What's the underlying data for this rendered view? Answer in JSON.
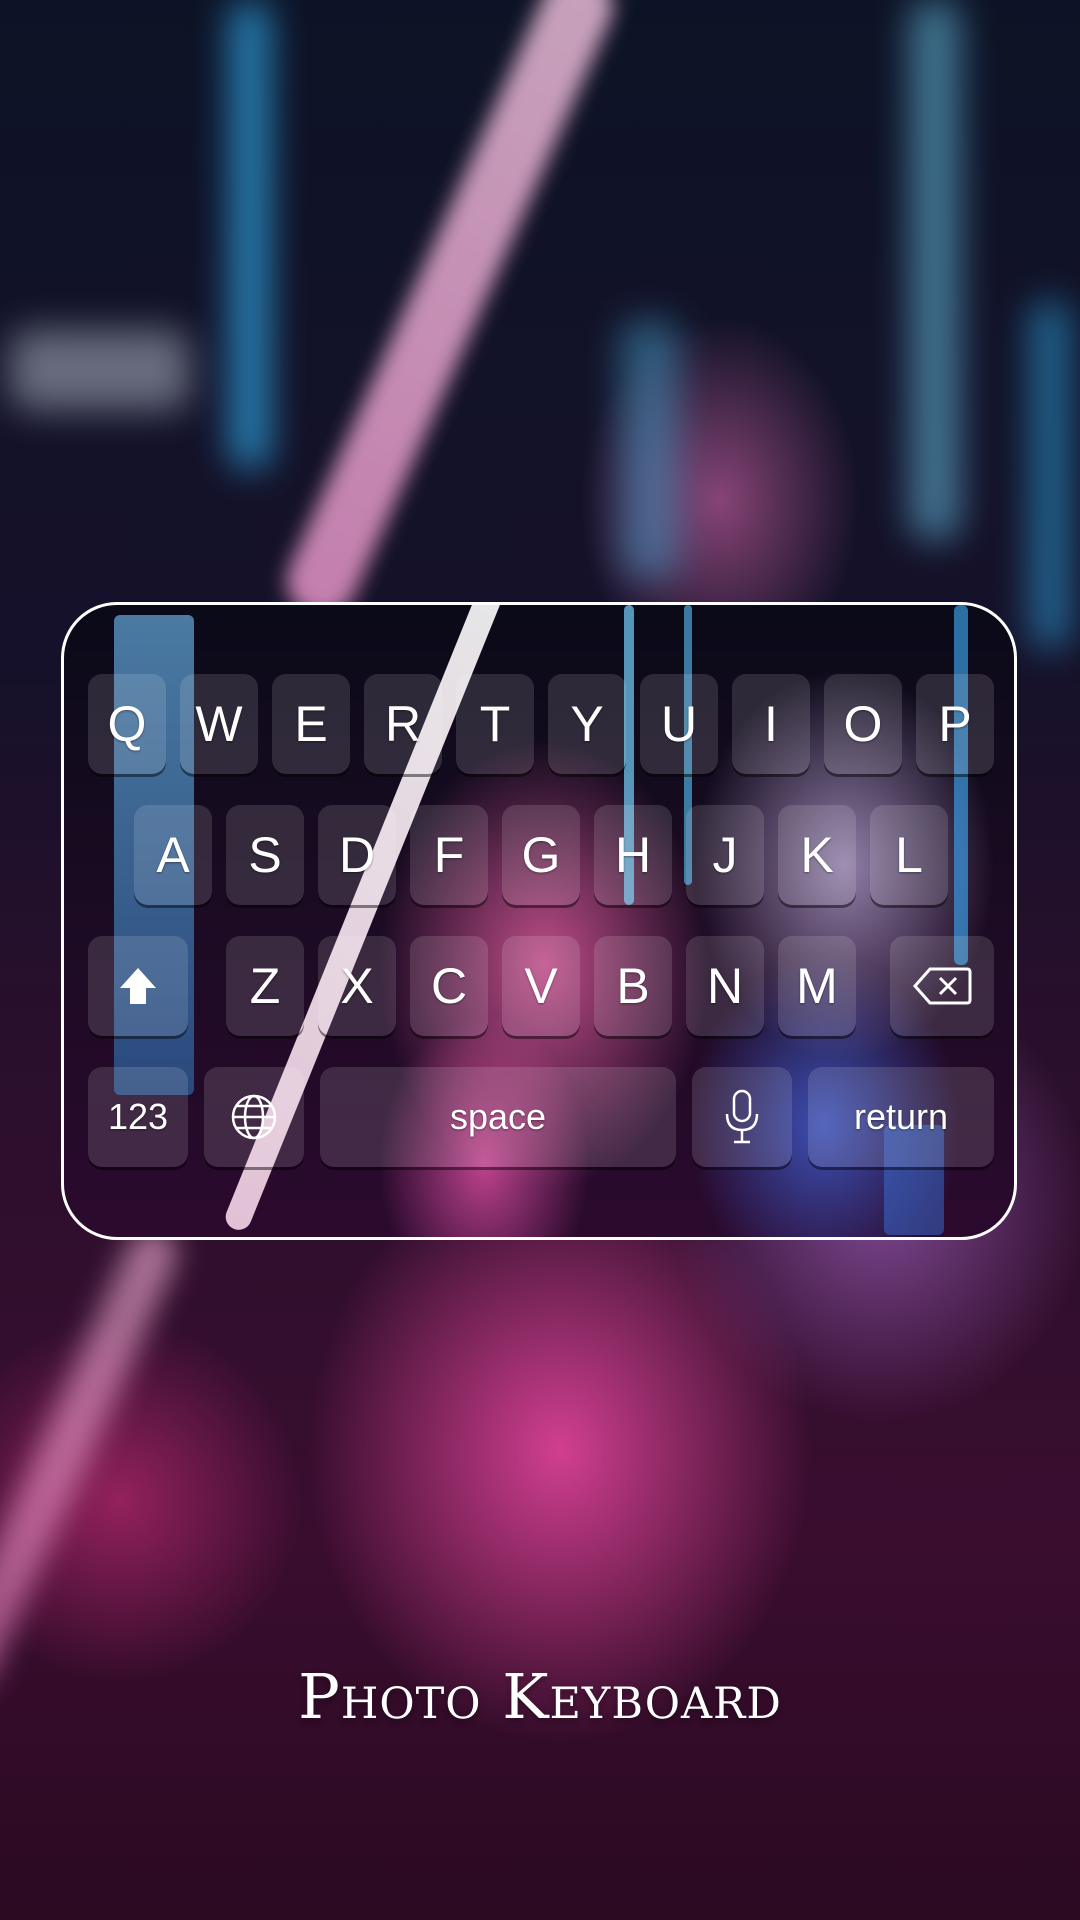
{
  "keyboard": {
    "row1": [
      "Q",
      "W",
      "E",
      "R",
      "T",
      "Y",
      "U",
      "I",
      "O",
      "P"
    ],
    "row2": [
      "A",
      "S",
      "D",
      "F",
      "G",
      "H",
      "J",
      "K",
      "L"
    ],
    "row3": [
      "Z",
      "X",
      "C",
      "V",
      "B",
      "N",
      "M"
    ],
    "numbers_label": "123",
    "space_label": "space",
    "return_label": "return",
    "icons": {
      "shift": "shift-up-arrow-icon",
      "delete": "backspace-icon",
      "globe": "globe-icon",
      "mic": "microphone-icon"
    }
  },
  "title": "Photo Keyboard",
  "colors": {
    "accent_pink": "#ec48a0",
    "accent_blue": "#2fa7e6",
    "text": "#ffffff"
  }
}
